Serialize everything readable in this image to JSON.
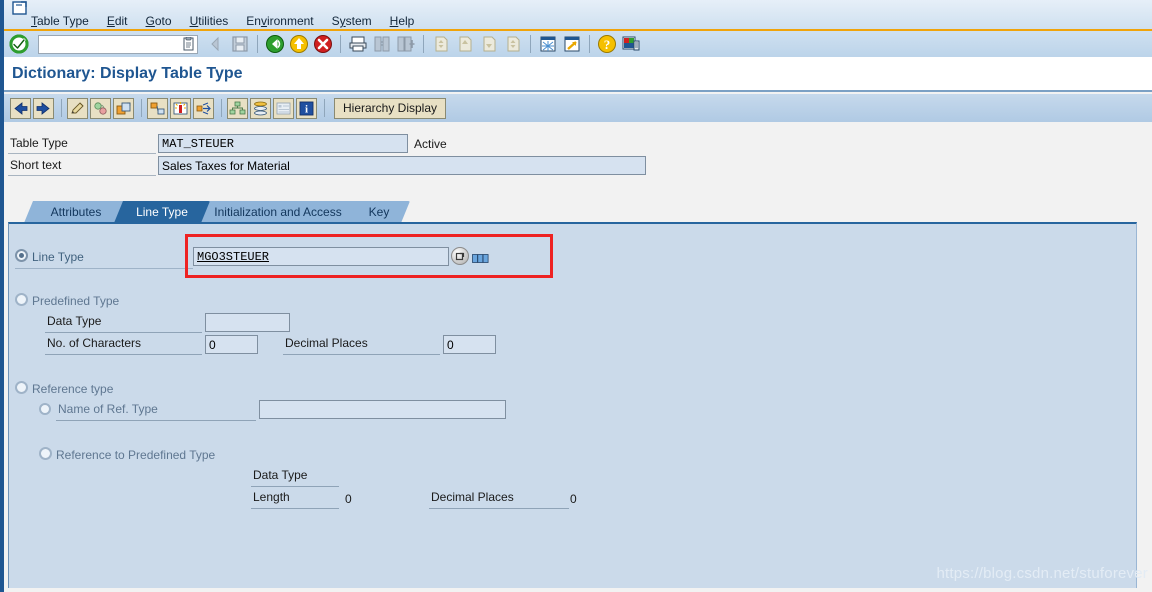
{
  "window": {
    "icon": "sap-window-icon"
  },
  "menu": {
    "items": [
      {
        "label": "Table Type",
        "accel": "T"
      },
      {
        "label": "Edit",
        "accel": "E"
      },
      {
        "label": "Goto",
        "accel": "G"
      },
      {
        "label": "Utilities",
        "accel": "U"
      },
      {
        "label": "Environment",
        "accel": "v"
      },
      {
        "label": "System",
        "accel": "y"
      },
      {
        "label": "Help",
        "accel": "H"
      }
    ]
  },
  "toolbar": {
    "command_value": "",
    "command_placeholder": "",
    "buttons": [
      {
        "name": "enter-check-icon",
        "title": "Enter"
      },
      {
        "name": "command-dropdown-icon",
        "title": "Command field dropdown"
      },
      {
        "name": "back-arrow-icon",
        "title": "Back"
      },
      {
        "name": "save-icon",
        "title": "Save"
      },
      {
        "name": "green-back-icon",
        "title": "Back"
      },
      {
        "name": "yellow-exit-icon",
        "title": "Exit"
      },
      {
        "name": "red-cancel-icon",
        "title": "Cancel"
      },
      {
        "name": "print-icon",
        "title": "Print"
      },
      {
        "name": "find-icon",
        "title": "Find"
      },
      {
        "name": "find-next-icon",
        "title": "Find Next"
      },
      {
        "name": "first-page-icon",
        "title": "First Page"
      },
      {
        "name": "previous-page-icon",
        "title": "Previous Page"
      },
      {
        "name": "next-page-icon",
        "title": "Next Page"
      },
      {
        "name": "last-page-icon",
        "title": "Last Page"
      },
      {
        "name": "create-session-icon",
        "title": "Create New Session"
      },
      {
        "name": "create-shortcut-icon",
        "title": "Create Shortcut"
      },
      {
        "name": "help-icon",
        "title": "Help"
      },
      {
        "name": "customize-layout-icon",
        "title": "Customizing of Local Layout"
      }
    ]
  },
  "title": "Dictionary: Display Table Type",
  "appbar": {
    "buttons": [
      {
        "name": "previous-object-icon",
        "title": "Previous Object"
      },
      {
        "name": "next-object-icon",
        "title": "Next Object"
      },
      {
        "name": "display-change-icon",
        "title": "Display <-> Change"
      },
      {
        "name": "activate-icon",
        "title": "Activate"
      },
      {
        "name": "other-object-icon",
        "title": "Other Object"
      },
      {
        "name": "where-used-list-icon",
        "title": "Where-Used List"
      },
      {
        "name": "runtime-object-icon",
        "title": "Runtime Object"
      },
      {
        "name": "expand-icon",
        "title": "Expand"
      },
      {
        "name": "hierarchy-icon",
        "title": "Hierarchy"
      },
      {
        "name": "stack-icon",
        "title": "Stack"
      },
      {
        "name": "list-icon",
        "title": "List"
      },
      {
        "name": "info-icon",
        "title": "Information"
      }
    ],
    "hierarchy_display_label": "Hierarchy Display"
  },
  "header": {
    "table_type_label": "Table Type",
    "table_type_value": "MAT_STEUER",
    "status": "Active",
    "short_text_label": "Short text",
    "short_text_value": "Sales Taxes for Material"
  },
  "tabs": [
    {
      "label": "Attributes",
      "selected": false
    },
    {
      "label": "Line Type",
      "selected": true
    },
    {
      "label": "Initialization and Access",
      "selected": false
    },
    {
      "label": "Key",
      "selected": false
    }
  ],
  "line_type_section": {
    "radio_label": "Line Type",
    "selected": true,
    "value": "MGO3STEUER",
    "nav_button_name": "navigate-to-object-button",
    "extra_icon_name": "value-help-icon"
  },
  "predefined_type_section": {
    "radio_label": "Predefined Type",
    "selected": false,
    "data_type_label": "Data Type",
    "data_type_value": "",
    "no_of_characters_label": "No. of Characters",
    "no_of_characters_value": "0",
    "decimal_places_label": "Decimal Places",
    "decimal_places_value": "0"
  },
  "reference_type_section": {
    "radio_label": "Reference type",
    "selected": false,
    "name_of_ref_type_label": "Name of Ref. Type",
    "name_of_ref_type_selected": false,
    "name_of_ref_type_value": ""
  },
  "reference_predefined_section": {
    "radio_label": "Reference to Predefined Type",
    "selected": false,
    "data_type_label": "Data Type",
    "length_label": "Length",
    "length_value": "0",
    "decimal_places_label": "Decimal Places",
    "decimal_places_value": "0"
  },
  "watermark": "https://blog.csdn.net/stuforever",
  "colors": {
    "accent_blue": "#1f5691",
    "menu_underline": "#f0a30a",
    "panel_bg": "#cbdaea",
    "input_bg": "#d6e2f0",
    "highlight_red": "#ee2222",
    "tab_selected": "#27659e",
    "tab_normal": "#8fb4d9"
  }
}
